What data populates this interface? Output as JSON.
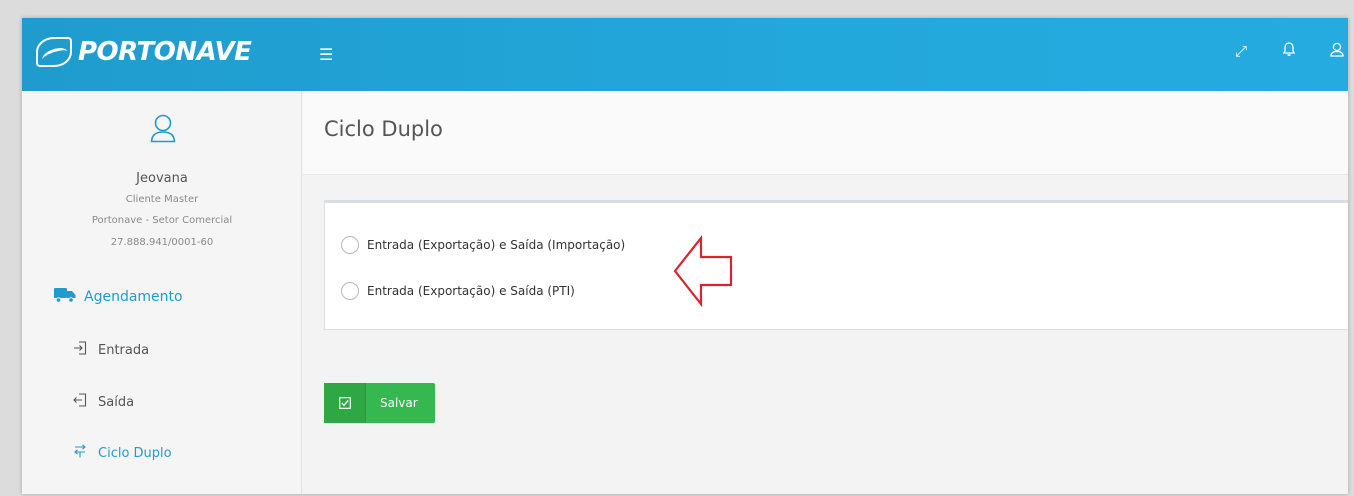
{
  "app": {
    "logo_text": "PORTONAVE"
  },
  "topbar": {
    "menu_icon": "hamburger-icon",
    "icons": [
      "expand-icon",
      "bell-icon",
      "user-icon"
    ]
  },
  "user": {
    "name": "Jeovana",
    "role": "Cliente Master",
    "company": "Portonave - Setor Comercial",
    "document": "27.888.941/0001-60"
  },
  "sidebar": {
    "section_label": "Agendamento",
    "items": [
      {
        "label": "Entrada",
        "icon": "enter-icon"
      },
      {
        "label": "Saída",
        "icon": "exit-icon"
      },
      {
        "label": "Ciclo Duplo",
        "icon": "cycle-icon"
      }
    ]
  },
  "page": {
    "title": "Ciclo Duplo",
    "options": [
      {
        "label": "Entrada (Exportação) e Saída (Importação)"
      },
      {
        "label": "Entrada (Exportação) e Saída (PTI)"
      }
    ],
    "save_label": "Salvar"
  },
  "colors": {
    "brand": "#1f9ccd",
    "save": "#34b84f",
    "annotation": "#d9232e"
  }
}
